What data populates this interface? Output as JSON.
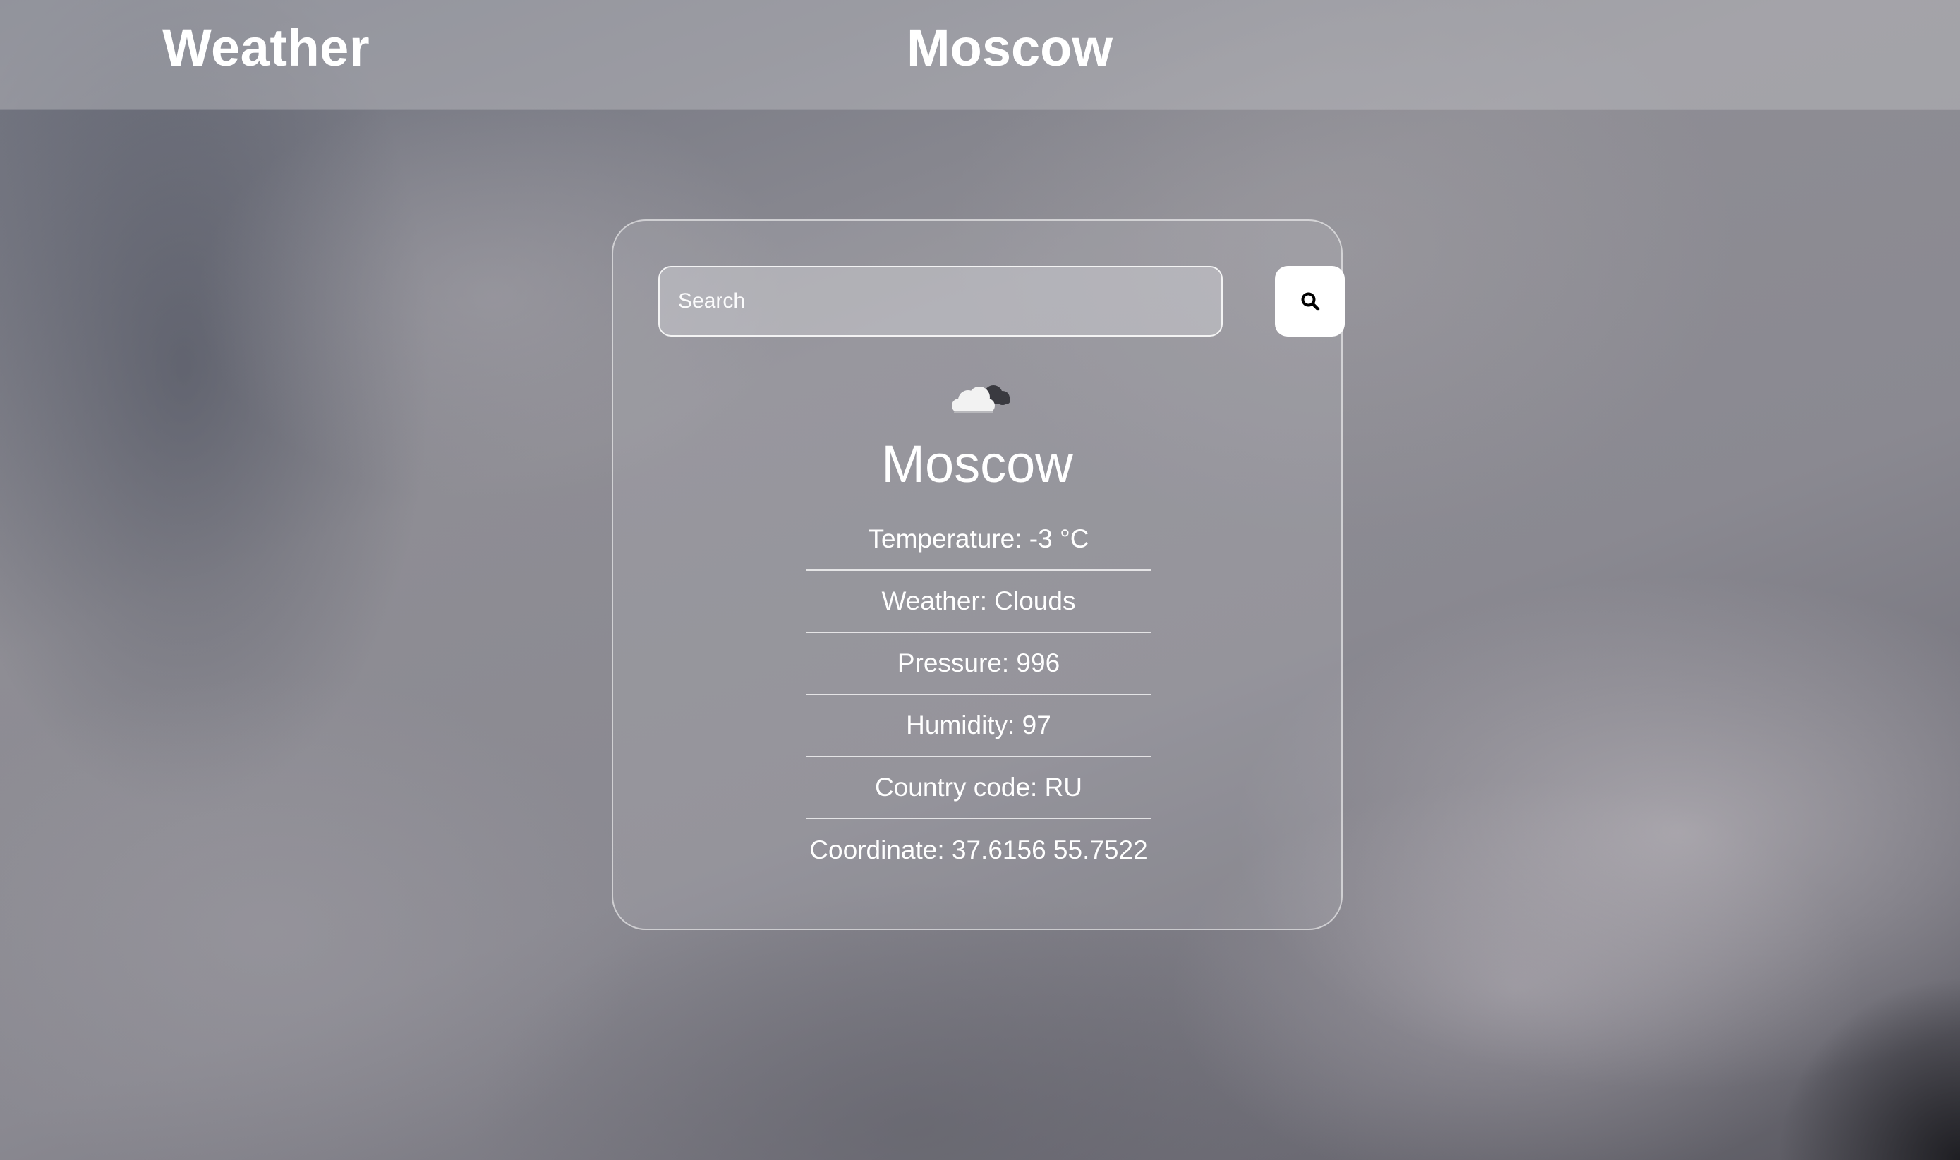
{
  "header": {
    "brand": "Weather",
    "city": "Moscow"
  },
  "search": {
    "placeholder": "Search",
    "value": "",
    "button_icon": "search-icon"
  },
  "weather": {
    "icon": "cloud-icon",
    "city": "Moscow",
    "details": [
      "Temperature: -3 °C",
      "Weather: Clouds",
      "Pressure: 996",
      "Humidity: 97",
      "Country code: RU",
      "Coordinate: 37.6156 55.7522"
    ]
  }
}
